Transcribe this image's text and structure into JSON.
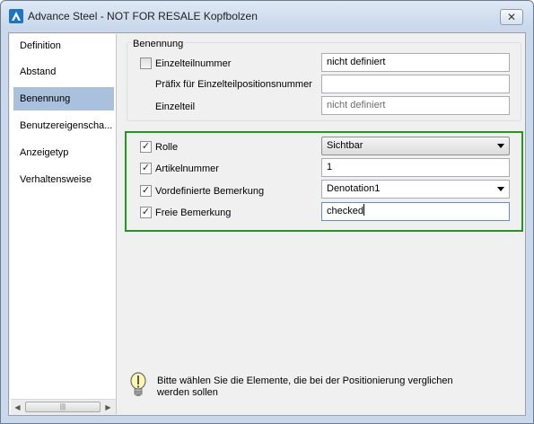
{
  "window": {
    "title": "Advance Steel - NOT FOR RESALE  Kopfbolzen",
    "close_glyph": "✕"
  },
  "sidebar": {
    "items": [
      {
        "label": "Definition",
        "selected": false
      },
      {
        "label": "Abstand",
        "selected": false
      },
      {
        "label": "Benennung",
        "selected": true
      },
      {
        "label": "Benutzereigenscha...",
        "selected": false
      },
      {
        "label": "Anzeigetyp",
        "selected": false
      },
      {
        "label": "Verhaltensweise",
        "selected": false
      }
    ],
    "scrollbar": {
      "left_arrow": "◀",
      "right_arrow": "▶",
      "thumb_grip": "|||"
    }
  },
  "benennung_group": {
    "title": "Benennung",
    "einzelteilnummer": {
      "label": "Einzelteilnummer",
      "checked": false,
      "value": "nicht definiert"
    },
    "praefix": {
      "label": "Präfix für Einzelteilpositionsnummer",
      "value": ""
    },
    "einzelteil": {
      "label": "Einzelteil",
      "placeholder": "nicht definiert"
    }
  },
  "options": {
    "rolle": {
      "label": "Rolle",
      "checked": true,
      "value": "Sichtbar"
    },
    "artikelnummer": {
      "label": "Artikelnummer",
      "checked": true,
      "value": "1"
    },
    "vordefinierte_bemerkung": {
      "label": "Vordefinierte Bemerkung",
      "checked": true,
      "value": "Denotation1"
    },
    "freie_bemerkung": {
      "label": "Freie Bemerkung",
      "checked": true,
      "value": "checked"
    }
  },
  "hint": {
    "text": "Bitte wählen Sie die Elemente, die bei der Positionierung verglichen werden sollen"
  },
  "colors": {
    "highlight_border": "#1f9a1f",
    "selected_nav": "#a9c1dd",
    "check_mark": "✓"
  }
}
